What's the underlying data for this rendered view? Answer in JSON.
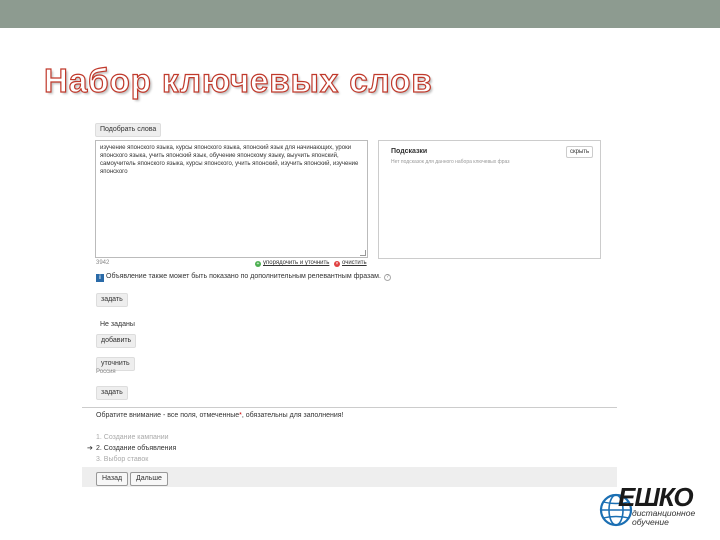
{
  "slide": {
    "title": "Набор ключевых слов"
  },
  "form": {
    "pick_words_button": "Подобрать слова",
    "keywords_text": "изучение японского языка, курсы японского языка, японский язык для начинающих, уроки японского языка, учить японский язык, обучение японскому языку, выучить японский, самоучитель японского языка, курсы японского, учить японский, изучить японский, изучение японского",
    "char_counter": "3942",
    "order_refine_label": "упорядочить и уточнить",
    "clear_label": "очистить",
    "hints": {
      "title": "Подсказки",
      "hide_button": "скрыть",
      "empty_text": "Нет подсказок для данного набора ключевых фраз"
    },
    "info_text": "Объявление также может быть показано по дополнительным релевантным фразам.",
    "set_button_1": "задать",
    "not_set_label": "Не заданы",
    "add_button": "добавить",
    "refine_button": "уточнить",
    "region_label": "Россия",
    "set_button_2": "задать",
    "required_note_prefix": "Обратите внимание - все поля, отмеченные",
    "required_star": "*",
    "required_note_suffix": ", обязательны для заполнения!",
    "steps": [
      {
        "label": "1. Создание кампании",
        "current": false
      },
      {
        "label": "2. Создание объявления",
        "current": true
      },
      {
        "label": "3. Выбор ставок",
        "current": false
      }
    ],
    "current_step_arrow": "➔",
    "back_button": "Назад",
    "next_button": "Дальше"
  },
  "logo": {
    "wordmark": "ЕШКО",
    "subtitle_line1": "дистанционное",
    "subtitle_line2": "обучение"
  },
  "colors": {
    "top_bar": "#8d9b90",
    "title_outline": "#c0392b",
    "info_icon": "#2a6aa8",
    "order_icon": "#4caf50",
    "clear_icon": "#e04040",
    "required_star": "#cc0000"
  },
  "icons": {
    "info": "info-icon",
    "help": "question-icon",
    "order": "plus-circle-icon",
    "clear": "x-circle-icon",
    "step_arrow": "arrow-right-icon",
    "logo_globe": "globe-icon"
  }
}
